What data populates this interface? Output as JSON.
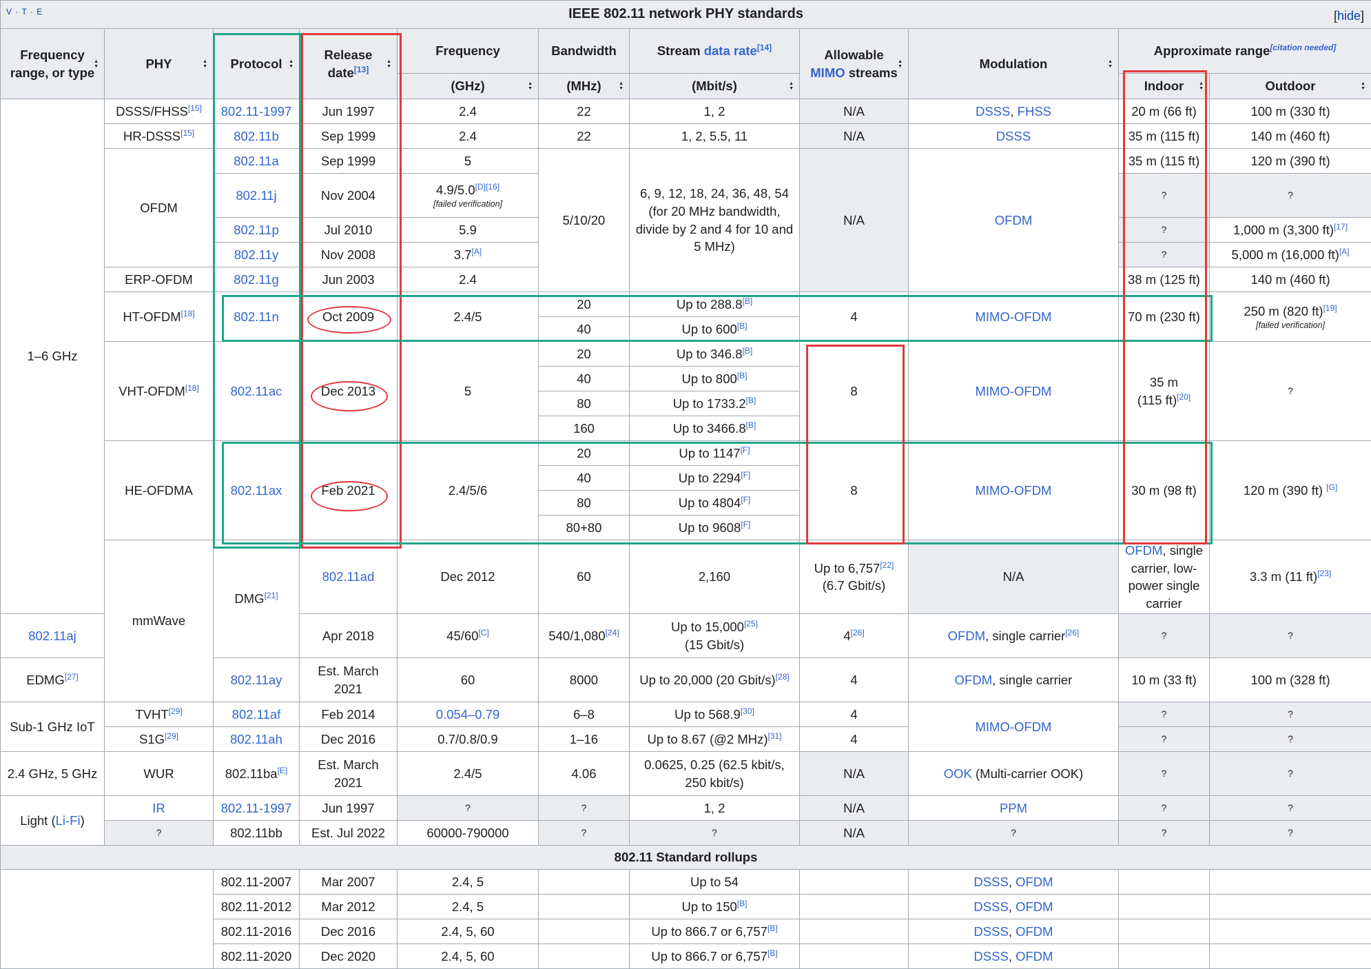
{
  "title": "IEEE 802.11 network PHY standards",
  "vte": "V · T · E",
  "hide_label": "hide",
  "headers": {
    "freq_range": "Frequency range, or type",
    "phy": "PHY",
    "protocol": "Protocol",
    "release": "Release date",
    "release_ref": "[13]",
    "frequency": "Frequency",
    "frequency_unit": "(GHz)",
    "bandwidth": "Bandwidth",
    "bandwidth_unit": "(MHz)",
    "stream_pre": "Stream ",
    "stream_link": "data rate",
    "stream_ref": "[14]",
    "stream_unit": "(Mbit/s)",
    "mimo_pre": "Allowable",
    "mimo_link": "MIMO",
    "mimo_post": " streams",
    "modulation": "Modulation",
    "range": "Approximate range",
    "range_cite": "[citation needed]",
    "indoor": "Indoor",
    "outdoor": "Outdoor"
  },
  "rows": {
    "g16": "1–6 GHz",
    "mmwave": "mmWave",
    "sub1": "Sub-1 GHz IoT",
    "g245": "2.4 GHz, 5 GHz",
    "light_pre": "Light (",
    "light_link": "Li-Fi",
    "light_post": ")",
    "dsss": {
      "phy": "DSSS/FHSS",
      "phy_ref": "[15]",
      "proto": "802.11-1997",
      "date": "Jun 1997",
      "freq": "2.4",
      "bw": "22",
      "rate": "1, 2",
      "mimo": "N/A",
      "mod1": "DSSS",
      "mod_sep": ", ",
      "mod2": "FHSS",
      "indoor": "20 m (66 ft)",
      "outdoor": "100 m (330 ft)"
    },
    "hrdsss": {
      "phy": "HR-DSSS",
      "phy_ref": "[15]",
      "proto": "802.11b",
      "date": "Sep 1999",
      "freq": "2.4",
      "bw": "22",
      "rate": "1, 2, 5.5, 11",
      "mimo": "N/A",
      "mod": "DSSS",
      "indoor": "35 m (115 ft)",
      "outdoor": "140 m (460 ft)"
    },
    "ofdm": {
      "phy": "OFDM",
      "bw": "5/10/20",
      "rate": "6, 9, 12, 18, 24, 36, 48, 54 (for 20 MHz bandwidth, divide by 2 and 4 for 10 and 5 MHz)",
      "mimo": "N/A",
      "mod": "OFDM"
    },
    "a": {
      "proto": "802.11a",
      "date": "Sep 1999",
      "freq": "5",
      "indoor": "35 m (115 ft)",
      "outdoor": "120 m (390 ft)"
    },
    "j": {
      "proto": "802.11j",
      "date": "Nov 2004",
      "freq": "4.9/5.0",
      "ref1": "[D]",
      "ref2": "[16]",
      "failed": "[failed verification]",
      "indoor": "?",
      "outdoor": "?"
    },
    "p": {
      "proto": "802.11p",
      "date": "Jul 2010",
      "freq": "5.9",
      "indoor": "?",
      "outdoor": "1,000 m (3,300 ft)",
      "outdoor_ref": "[17]"
    },
    "y": {
      "proto": "802.11y",
      "date": "Nov 2008",
      "freq": "3.7",
      "freq_ref": "[A]",
      "indoor": "?",
      "outdoor": "5,000 m (16,000 ft)",
      "outdoor_ref": "[A]"
    },
    "g": {
      "phy": "ERP-OFDM",
      "proto": "802.11g",
      "date": "Jun 2003",
      "freq": "2.4",
      "indoor": "38 m (125 ft)",
      "outdoor": "140 m (460 ft)"
    },
    "n": {
      "phy": "HT-OFDM",
      "phy_ref": "[18]",
      "proto": "802.11n",
      "date": "Oct 2009",
      "freq": "2.4/5",
      "bw1": "20",
      "rate1": "Up to 288.8",
      "bw2": "40",
      "rate2": "Up to 600",
      "ref": "[B]",
      "mimo": "4",
      "mod": "MIMO-OFDM",
      "indoor": "70 m (230 ft)",
      "outdoor": "250 m (820 ft)",
      "outdoor_ref": "[19]",
      "failed": "[failed verification]"
    },
    "ac": {
      "phy": "VHT-OFDM",
      "phy_ref": "[18]",
      "proto": "802.11ac",
      "date": "Dec 2013",
      "freq": "5",
      "bw1": "20",
      "rate1": "Up to 346.8",
      "bw2": "40",
      "rate2": "Up to 800",
      "bw3": "80",
      "rate3": "Up to 1733.2",
      "bw4": "160",
      "rate4": "Up to 3466.8",
      "ref": "[B]",
      "mimo": "8",
      "mod": "MIMO-OFDM",
      "indoor1": "35 m",
      "indoor2": "(115 ft)",
      "indoor_ref": "[20]",
      "outdoor": "?"
    },
    "ax": {
      "phy": "HE-OFDMA",
      "proto": "802.11ax",
      "date": "Feb 2021",
      "freq": "2.4/5/6",
      "bw1": "20",
      "rate1": "Up to 1147",
      "bw2": "40",
      "rate2": "Up to 2294",
      "bw3": "80",
      "rate3": "Up to 4804",
      "bw4": "80+80",
      "rate4": "Up to 9608",
      "ref": "[F]",
      "mimo": "8",
      "mod": "MIMO-OFDM",
      "indoor": "30 m (98 ft)",
      "outdoor": "120 m (390 ft) ",
      "outdoor_ref": "[G]"
    },
    "dmg": {
      "phy": "DMG",
      "phy_ref": "[21]"
    },
    "ad": {
      "proto": "802.11ad",
      "date": "Dec 2012",
      "freq": "60",
      "bw": "2,160",
      "rate1": "Up to 6,757",
      "rate_ref": "[22]",
      "rate2": "(6.7 Gbit/s)",
      "mimo": "N/A",
      "mod_link": "OFDM",
      "mod_rest": ", single carrier, low-power single carrier",
      "indoor": "3.3 m (11 ft)",
      "indoor_ref": "[23]",
      "outdoor": "?"
    },
    "aj": {
      "proto": "802.11aj",
      "date": "Apr 2018",
      "freq": "45/60",
      "freq_ref": "[C]",
      "bw": "540/1,080",
      "bw_ref": "[24]",
      "rate1": "Up to 15,000",
      "rate_ref": "[25]",
      "rate2": "(15 Gbit/s)",
      "mimo": "4",
      "mimo_ref": "[26]",
      "mod_link": "OFDM",
      "mod_rest": ", single carrier",
      "mod_ref": "[26]",
      "indoor": "?",
      "outdoor": "?"
    },
    "ay": {
      "phy": "EDMG",
      "phy_ref": "[27]",
      "proto": "802.11ay",
      "date": "Est. March 2021",
      "freq": "60",
      "bw": "8000",
      "rate": "Up to 20,000 (20 Gbit/s)",
      "rate_ref": "[28]",
      "mimo": "4",
      "mod_link": "OFDM",
      "mod_rest": ", single carrier",
      "indoor": "10 m (33 ft)",
      "outdoor": "100 m (328 ft)"
    },
    "af": {
      "phy": "TVHT",
      "phy_ref": "[29]",
      "proto": "802.11af",
      "date": "Feb 2014",
      "freq": "0.054–0.79",
      "bw": "6–8",
      "rate": "Up to 568.9",
      "rate_ref": "[30]",
      "mimo": "4",
      "mod": "MIMO-OFDM",
      "indoor": "?",
      "outdoor": "?"
    },
    "ah": {
      "phy": "S1G",
      "phy_ref": "[29]",
      "proto": "802.11ah",
      "date": "Dec 2016",
      "freq": "0.7/0.8/0.9",
      "bw": "1–16",
      "rate": "Up to 8.67 (@2 MHz)",
      "rate_ref": "[31]",
      "mimo": "4",
      "indoor": "?",
      "outdoor": "?"
    },
    "ba": {
      "phy": "WUR",
      "proto": "802.11ba",
      "proto_ref": "[E]",
      "date": "Est. March 2021",
      "freq": "2.4/5",
      "bw": "4.06",
      "rate": "0.0625, 0.25 (62.5 kbit/s, 250 kbit/s)",
      "mimo": "N/A",
      "mod_link": "OOK",
      "mod_rest": " (Multi-carrier OOK)",
      "indoor": "?",
      "outdoor": "?"
    },
    "ir": {
      "phy": "IR",
      "proto": "802.11-1997",
      "date": "Jun 1997",
      "freq": "?",
      "bw": "?",
      "rate": "1, 2",
      "mimo": "N/A",
      "mod": "PPM",
      "indoor": "?",
      "outdoor": "?"
    },
    "bb": {
      "phy": "?",
      "proto": "802.11bb",
      "date": "Est. Jul 2022",
      "freq": "60000-790000",
      "bw": "?",
      "rate": "?",
      "mimo": "N/A",
      "mod": "?",
      "indoor": "?",
      "outdoor": "?"
    }
  },
  "rollups": {
    "title": "802.11 Standard rollups",
    "r2007": {
      "proto": "802.11-2007",
      "date": "Mar 2007",
      "freq": "2.4, 5",
      "rate": "Up to 54",
      "mod1": "DSSS",
      "mod2": "OFDM"
    },
    "r2012": {
      "proto": "802.11-2012",
      "date": "Mar 2012",
      "freq": "2.4, 5",
      "rate": "Up to 150",
      "rate_ref": "[B]",
      "mod1": "DSSS",
      "mod2": "OFDM"
    },
    "r2016": {
      "proto": "802.11-2016",
      "date": "Dec 2016",
      "freq": "2.4, 5, 60",
      "rate": "Up to 866.7 or 6,757",
      "rate_ref": "[B]",
      "mod1": "DSSS",
      "mod2": "OFDM"
    },
    "r2020": {
      "proto": "802.11-2020",
      "date": "Dec 2020",
      "freq": "2.4, 5, 60",
      "rate": "Up to 866.7 or 6,757",
      "rate_ref": "[B]",
      "mod1": "DSSS",
      "mod2": "OFDM"
    },
    "sep": ", "
  },
  "colors": {
    "highlight_green": "#1fa68a",
    "highlight_red": "#e0393b",
    "header_bg": "#eaecf0",
    "link": "#3366cc"
  }
}
